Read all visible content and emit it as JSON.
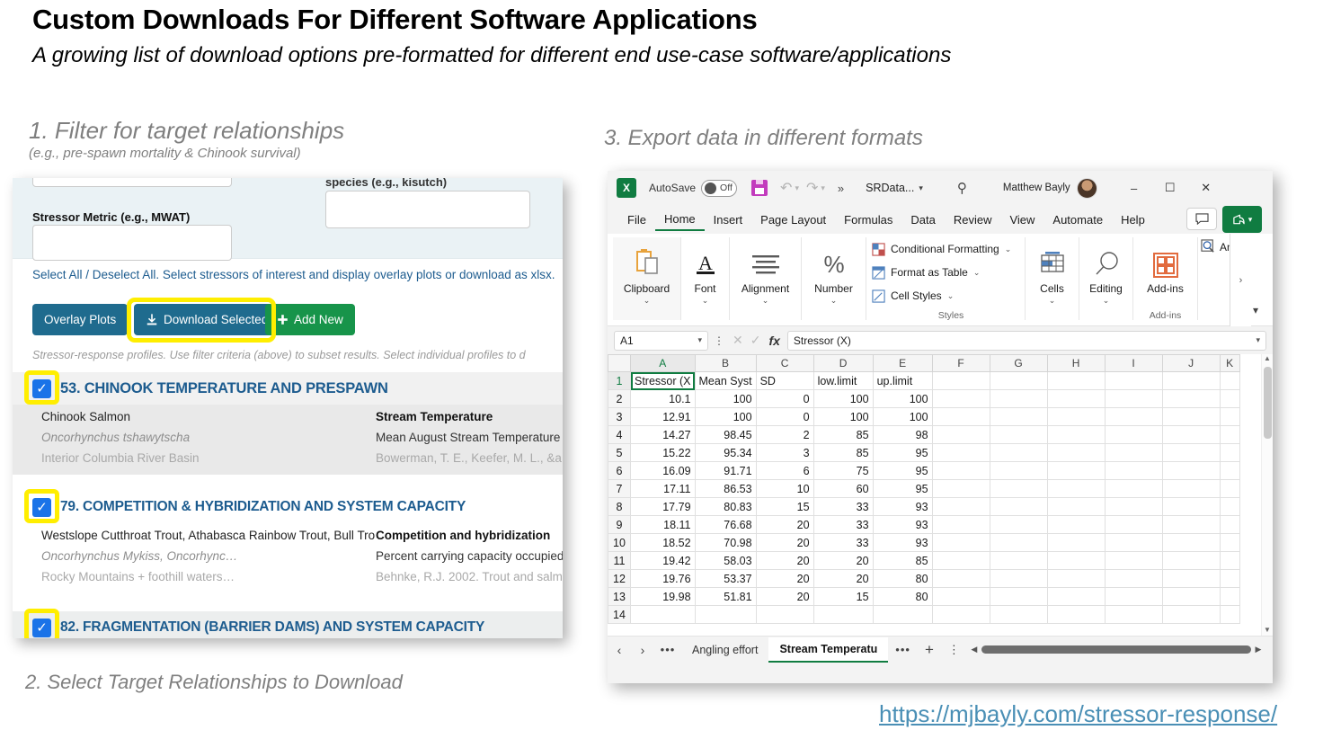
{
  "slide": {
    "title": "Custom Downloads For Different Software Applications",
    "subtitle": "A growing list of download options pre-formatted for different end use-case software/applications",
    "step1_caption": "1.   Filter for target relationships",
    "step1_sub": "(e.g., pre-spawn mortality & Chinook survival)",
    "step2_caption": "2. Select Target Relationships to Download",
    "step3_caption": "3. Export data in different formats",
    "url": "https://mjbayly.com/stressor-response/",
    "highlight_color": "#ffee00"
  },
  "app": {
    "filters": {
      "species_label": "species (e.g., kisutch)",
      "species_value": "",
      "metric_label": "Stressor Metric (e.g., MWAT)",
      "metric_value": ""
    },
    "select_all_line": "Select All / Deselect All. Select stressors of interest and display overlay plots or download as xlsx.",
    "buttons": {
      "overlay": "Overlay Plots",
      "download": "Download Selected",
      "download_icon": "download-icon",
      "add_new": "Add New",
      "add_new_icon": "plus-icon"
    },
    "helper_note": "Stressor-response profiles. Use filter criteria (above) to subset results. Select individual profiles to d",
    "relationships": [
      {
        "checked": true,
        "title": "53. CHINOOK TEMPERATURE AND PRESPAWN",
        "left1": "Chinook Salmon",
        "left2": "Oncorhynchus tshawytscha",
        "left3": "Interior Columbia River Basin",
        "right1": "Stream Temperature",
        "right2": "Mean August Stream Temperature °",
        "right3": "Bowerman, T. E., Keefer, M. L., &a.."
      },
      {
        "checked": true,
        "title": "79. COMPETITION & HYBRIDIZATION AND SYSTEM CAPACITY",
        "left1": "Westslope Cutthroat Trout, Athabasca Rainbow Trout, Bull Tro",
        "left2": "Oncorhynchus Mykiss, Oncorhync…",
        "left3": "Rocky Mountains + foothill waters…",
        "right1": "Competition and hybridization",
        "right2": "Percent carrying capacity occupied..",
        "right3": "Behnke, R.J. 2002. Trout and salm.."
      },
      {
        "checked": true,
        "title": "82. FRAGMENTATION (BARRIER DAMS) AND SYSTEM CAPACITY",
        "left1": "",
        "left2": "",
        "left3": "",
        "right1": "",
        "right2": "",
        "right3": ""
      }
    ]
  },
  "excel": {
    "titlebar": {
      "app_icon": "excel-logo-icon",
      "autosave_label": "AutoSave",
      "autosave_state": "Off",
      "save_icon": "save-icon",
      "undo_icon": "undo-icon",
      "redo_icon": "redo-icon",
      "more_commands": "»",
      "doc_name": "SRData...",
      "search_icon": "search-icon",
      "user": "Matthew Bayly",
      "avatar": "user-avatar",
      "minimize": "–",
      "maximize": "☐",
      "close": "✕"
    },
    "ribbon_tabs": [
      "File",
      "Home",
      "Insert",
      "Page Layout",
      "Formulas",
      "Data",
      "Review",
      "View",
      "Automate",
      "Help"
    ],
    "active_tab": "Home",
    "comments_icon": "comment-icon",
    "share_label": "share-icon",
    "ribbon_groups": [
      {
        "label": "Clipboard",
        "icon": "clipboard-icon",
        "caret": "⌄"
      },
      {
        "label": "Font",
        "icon": "font-a-icon",
        "caret": "⌄"
      },
      {
        "label": "Alignment",
        "icon": "alignment-icon",
        "caret": "⌄"
      },
      {
        "label": "Number",
        "icon": "percent-icon",
        "caret": "⌄"
      },
      {
        "label": "Cells",
        "icon": "cells-table-icon",
        "caret": "⌄"
      },
      {
        "label": "Editing",
        "icon": "editing-magnifier-icon",
        "caret": "⌄"
      },
      {
        "label": "Add-ins",
        "icon": "add-ins-icon",
        "caret": ""
      }
    ],
    "styles_group": {
      "label": "Styles",
      "items": [
        {
          "label": "Conditional Formatting",
          "icon": "conditional-formatting-icon",
          "caret": "⌄"
        },
        {
          "label": "Format as Table",
          "icon": "format-as-table-icon",
          "caret": "⌄"
        },
        {
          "label": "Cell Styles",
          "icon": "cell-styles-icon",
          "caret": "⌄"
        }
      ]
    },
    "addins_group_label": "Add-ins",
    "analyze_label": "An",
    "analyze_icon": "analyze-data-icon",
    "formula_bar": {
      "name_box": "A1",
      "cancel_icon": "cancel-icon",
      "confirm_icon": "confirm-icon",
      "fx_icon": "fx-icon",
      "value": "Stressor (X)"
    },
    "grid": {
      "columns": [
        "A",
        "B",
        "C",
        "D",
        "E",
        "F",
        "G",
        "H",
        "I",
        "J",
        "K"
      ],
      "rows": [
        {
          "n": 1,
          "cells": [
            "Stressor (X",
            "Mean Syst",
            "SD",
            "low.limit",
            "up.limit",
            "",
            "",
            "",
            "",
            "",
            ""
          ],
          "header": true
        },
        {
          "n": 2,
          "cells": [
            "10.1",
            "100",
            "0",
            "100",
            "100",
            "",
            "",
            "",
            "",
            "",
            ""
          ]
        },
        {
          "n": 3,
          "cells": [
            "12.91",
            "100",
            "0",
            "100",
            "100",
            "",
            "",
            "",
            "",
            "",
            ""
          ]
        },
        {
          "n": 4,
          "cells": [
            "14.27",
            "98.45",
            "2",
            "85",
            "98",
            "",
            "",
            "",
            "",
            "",
            ""
          ]
        },
        {
          "n": 5,
          "cells": [
            "15.22",
            "95.34",
            "3",
            "85",
            "95",
            "",
            "",
            "",
            "",
            "",
            ""
          ]
        },
        {
          "n": 6,
          "cells": [
            "16.09",
            "91.71",
            "6",
            "75",
            "95",
            "",
            "",
            "",
            "",
            "",
            ""
          ]
        },
        {
          "n": 7,
          "cells": [
            "17.11",
            "86.53",
            "10",
            "60",
            "95",
            "",
            "",
            "",
            "",
            "",
            ""
          ]
        },
        {
          "n": 8,
          "cells": [
            "17.79",
            "80.83",
            "15",
            "33",
            "93",
            "",
            "",
            "",
            "",
            "",
            ""
          ]
        },
        {
          "n": 9,
          "cells": [
            "18.11",
            "76.68",
            "20",
            "33",
            "93",
            "",
            "",
            "",
            "",
            "",
            ""
          ]
        },
        {
          "n": 10,
          "cells": [
            "18.52",
            "70.98",
            "20",
            "33",
            "93",
            "",
            "",
            "",
            "",
            "",
            ""
          ]
        },
        {
          "n": 11,
          "cells": [
            "19.42",
            "58.03",
            "20",
            "20",
            "85",
            "",
            "",
            "",
            "",
            "",
            ""
          ]
        },
        {
          "n": 12,
          "cells": [
            "19.76",
            "53.37",
            "20",
            "20",
            "80",
            "",
            "",
            "",
            "",
            "",
            ""
          ]
        },
        {
          "n": 13,
          "cells": [
            "19.98",
            "51.81",
            "20",
            "15",
            "80",
            "",
            "",
            "",
            "",
            "",
            ""
          ]
        },
        {
          "n": 14,
          "cells": [
            "",
            "",
            "",
            "",
            "",
            "",
            "",
            "",
            "",
            "",
            ""
          ]
        }
      ]
    },
    "sheet_bar": {
      "prev": "‹",
      "next": "›",
      "dots": "•••",
      "tabs": [
        {
          "label": "Angling effort",
          "active": false
        },
        {
          "label": "Stream Temperatu",
          "active": true
        }
      ],
      "overflow": "•••",
      "add": "+",
      "kebab": "⋮"
    }
  }
}
